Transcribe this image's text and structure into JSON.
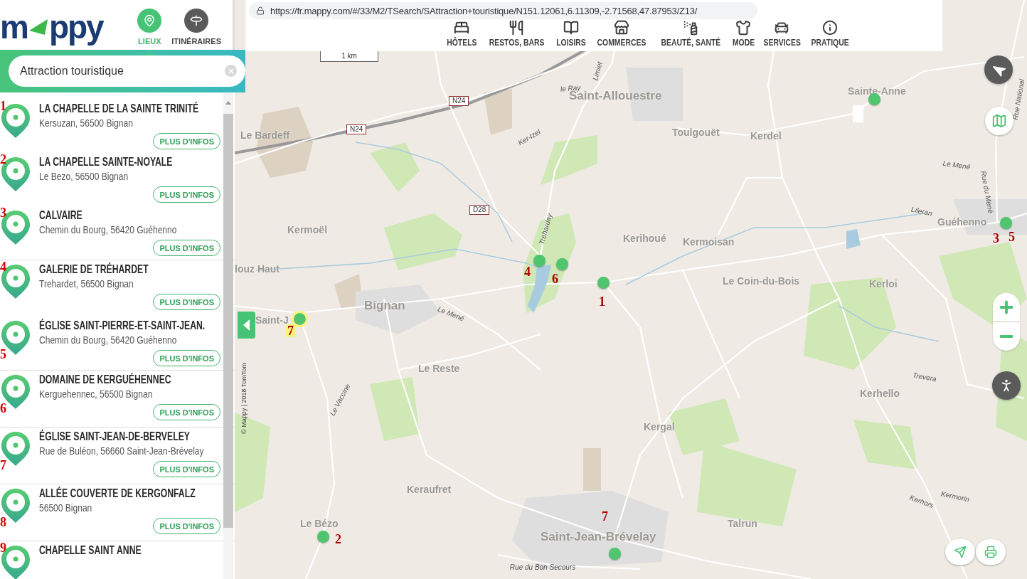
{
  "app_header": {
    "logo": {
      "before": "m",
      "after": "ppy"
    },
    "modes": [
      {
        "label": "LIEUX",
        "kind": "places",
        "selected": true
      },
      {
        "label": "ITINÉRAIRES",
        "kind": "routes",
        "selected": false
      }
    ]
  },
  "search": {
    "value": "Attraction touristique"
  },
  "results": [
    {
      "note": "1",
      "title": "LA CHAPELLE DE LA SAINTE TRINITÉ",
      "address": "Kersuzan, 56500 Bignan",
      "action": "PLUS D'INFOS"
    },
    {
      "note": "2",
      "title": "LA CHAPELLE SAINTE-NOYALE",
      "address": "Le Bezo, 56500 Bignan",
      "action": "PLUS D'INFOS"
    },
    {
      "note": "3",
      "title": "CALVAIRE",
      "address": "Chemin du Bourg, 56420 Guéhenno",
      "action": "PLUS D'INFOS"
    },
    {
      "note": "4",
      "title": "GALERIE DE TRÉHARDET",
      "address": "Trehardet, 56500 Bignan",
      "action": "PLUS D'INFOS"
    },
    {
      "note": "5",
      "title": "ÉGLISE SAINT-PIERRE-ET-SAINT-JEAN.",
      "address": "Chemin du Bourg, 56420 Guéhenno",
      "action": "PLUS D'INFOS"
    },
    {
      "note": "6",
      "title": "DOMAINE DE KERGUÉHENNEC",
      "address": "Kerguehennec, 56500 Bignan",
      "action": "PLUS D'INFOS"
    },
    {
      "note": "7",
      "title": "ÉGLISE SAINT-JEAN-DE-BERVELEY",
      "address": "Rue de Buléon, 56660 Saint-Jean-Brévelay",
      "action": "PLUS D'INFOS"
    },
    {
      "note": "8",
      "title": "ALLÉE COUVERTE DE KERGONFALZ",
      "address": "56500 Bignan",
      "action": "PLUS D'INFOS"
    },
    {
      "note": "9",
      "title": "CHAPELLE SAINT ANNE"
    }
  ],
  "address_bar": {
    "url": "https://fr.mappy.com/#/33/M2/TSearch/SAttraction+touristique/N151.12061,6.11309,-2.71568,47.87953/Z13/"
  },
  "categories": [
    {
      "label": "HÔTELS",
      "kind": "hotels"
    },
    {
      "label": "RESTOS, BARS",
      "kind": "restaurants"
    },
    {
      "label": "LOISIRS",
      "kind": "leisure"
    },
    {
      "label": "COMMERCES",
      "kind": "shops"
    },
    {
      "label": "BEAUTÉ, SANTÉ",
      "kind": "beauty"
    },
    {
      "label": "MODE",
      "kind": "fashion"
    },
    {
      "label": "SERVICES",
      "kind": "services"
    },
    {
      "label": "PRATIQUE",
      "kind": "info"
    }
  ],
  "map": {
    "scale": "1 km",
    "copyright": "© Mappy | 2018 TomTom",
    "shields": [
      "N24",
      "N24",
      "D28"
    ],
    "places": [
      "Saint-Allouestre",
      "Sainte-Anne",
      "Le Bardeff",
      "Toulgouët",
      "Kerdel",
      "Kermoël",
      "Kerihoué",
      "Kermoisan",
      "Guéhenno",
      "louz Haut",
      "Le Coin-du-Bois",
      "Kerloi",
      "Bignan",
      "Saint-J",
      "Le Reste",
      "Kerhello",
      "Kergal",
      "Keraufret",
      "Talrun",
      "Le Bézo",
      "Saint-Jean-Brévelay"
    ],
    "streets": [
      "le Ray",
      "Limiet",
      "Ker-Izel",
      "Treharday",
      "Le Mené",
      "Le Vaccine",
      "Le Mené",
      "Rue du Mené",
      "Lileran",
      "Trevera",
      "Kermorin",
      "Kerhors",
      "Rue du Bon Secours",
      "Rue National"
    ],
    "markers": [
      {
        "highlighted": false
      },
      {
        "notes": [
          "3",
          "5"
        ],
        "highlighted": false
      },
      {
        "notes": [
          "4"
        ],
        "highlighted": false
      },
      {
        "notes": [
          "6"
        ],
        "highlighted": false
      },
      {
        "notes": [
          "1"
        ],
        "highlighted": false
      },
      {
        "notes": [
          "7"
        ],
        "highlighted": true
      },
      {
        "notes": [
          "2"
        ],
        "highlighted": false
      },
      {
        "notes": [
          "7"
        ],
        "highlighted": false
      }
    ]
  }
}
